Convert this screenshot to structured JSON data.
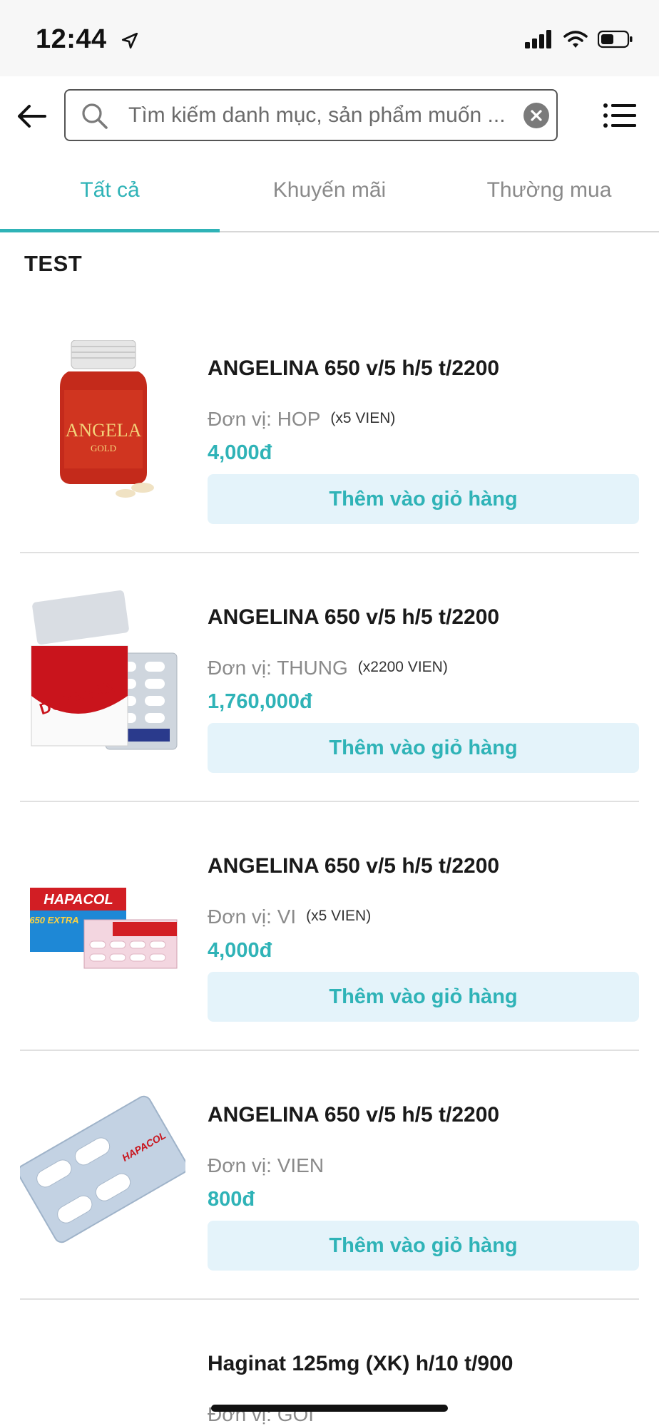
{
  "status_bar": {
    "time": "12:44"
  },
  "header": {
    "search_placeholder": "Tìm kiếm danh mục, sản phẩm muốn ..."
  },
  "tabs": [
    {
      "label": "Tất cả",
      "active": true
    },
    {
      "label": "Khuyến mãi",
      "active": false
    },
    {
      "label": "Thường mua",
      "active": false
    }
  ],
  "section_title": "TEST",
  "products": [
    {
      "name": "ANGELINA 650 v/5 h/5 t/2200",
      "unit": "Đơn vị: HOP",
      "qty": "(x5 VIEN)",
      "price": "4,000đ",
      "add_label": "Thêm vào giỏ hàng",
      "image_label": "ANGELA"
    },
    {
      "name": "ANGELINA 650 v/5 h/5 t/2200",
      "unit": "Đơn vị: THUNG",
      "qty": "(x2200 VIEN)",
      "price": "1,760,000đ",
      "add_label": "Thêm vào giỏ hàng",
      "image_label": "DOPAGAN"
    },
    {
      "name": "ANGELINA 650 v/5 h/5 t/2200",
      "unit": "Đơn vị: VI",
      "qty": "(x5 VIEN)",
      "price": "4,000đ",
      "add_label": "Thêm vào giỏ hàng",
      "image_label": "HAPACOL"
    },
    {
      "name": "ANGELINA 650 v/5 h/5 t/2200",
      "unit": "Đơn vị: VIEN",
      "qty": "",
      "price": "800đ",
      "add_label": "Thêm vào giỏ hàng",
      "image_label": "HAPACOL"
    },
    {
      "name": "Haginat 125mg (XK) h/10 t/900",
      "unit": "Đơn vị: GOI",
      "qty": "",
      "price": "",
      "add_label": "",
      "image_label": ""
    }
  ],
  "colors": {
    "accent": "#2fb3b7",
    "button_bg": "#e4f3fa"
  }
}
